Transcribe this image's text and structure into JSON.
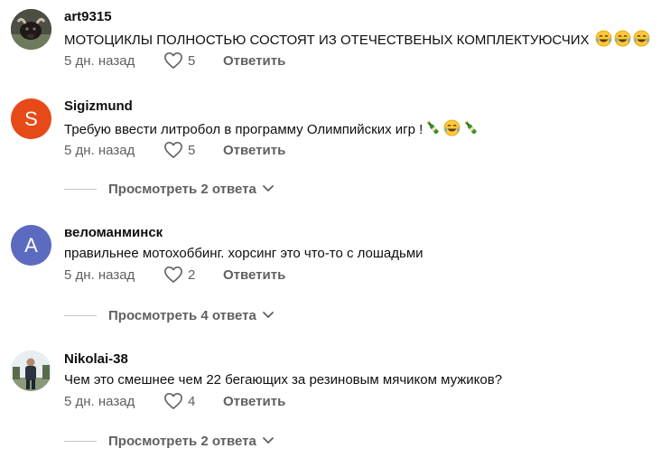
{
  "comments": [
    {
      "author": "art9315",
      "text": "МОТОЦИКЛЫ ПОЛНОСТЬЮ СОСТОЯТ ИЗ ОТЕЧЕСТВЕНЫХ КОМПЛЕКТУЮСЧИХ",
      "time": "5 дн. назад",
      "likes": "5",
      "reply_label": "Ответить",
      "avatar_icon": "bull-photo"
    },
    {
      "author": "Sigizmund",
      "text": "Требую ввести литробол в программу Олимпийских игр !",
      "time": "5 дн. назад",
      "likes": "5",
      "reply_label": "Ответить",
      "avatar_letter": "S",
      "avatar_color": "#e64a19",
      "view_replies": "Просмотреть 2 ответа"
    },
    {
      "author": "веломанминск",
      "text": "правильнее мотохоббинг. хорсинг это что-то с лошадьми",
      "time": "5 дн. назад",
      "likes": "2",
      "reply_label": "Ответить",
      "avatar_letter": "A",
      "avatar_color": "#5c6bc0",
      "view_replies": "Просмотреть 4 ответа"
    },
    {
      "author": "Nikolai-38",
      "text": "Чем это смешнее чем 22 бегающих за резиновым мячиком мужиков?",
      "time": "5 дн. назад",
      "likes": "4",
      "reply_label": "Ответить",
      "avatar_icon": "person-photo",
      "view_replies": "Просмотреть 2 ответа"
    }
  ]
}
